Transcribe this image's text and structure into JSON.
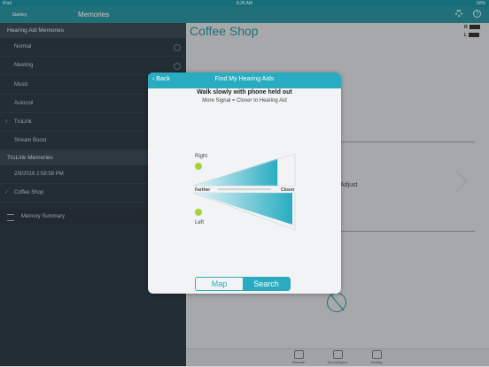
{
  "status_bar": {
    "left": "iPad",
    "time": "8:36 AM",
    "right": "50%"
  },
  "sidebar": {
    "logo": "Starkey",
    "title": "Memories",
    "sections": [
      {
        "label": "Hearing Aid Memories"
      },
      {
        "label": "TruLink Memories"
      }
    ],
    "hearing_aid_items": [
      {
        "label": "Normal",
        "checked": false
      },
      {
        "label": "Meeting",
        "checked": false
      },
      {
        "label": "Music",
        "checked": false
      },
      {
        "label": "Autocoil",
        "checked": false
      },
      {
        "label": "TruLink",
        "checked": true
      },
      {
        "label": "Stream Boost",
        "checked": false
      }
    ],
    "trulink_items": [
      {
        "label": "2/9/2016 2:58:58 PM",
        "checked": false
      },
      {
        "label": "Coffee Shop",
        "checked": true
      }
    ],
    "summary_label": "Memory Summary"
  },
  "main": {
    "title": "Coffee Shop",
    "battery_r": "R",
    "battery_l": "L",
    "adjust_label": "Adjust",
    "tabs": [
      {
        "label": "Remote"
      },
      {
        "label": "SoundSpace"
      },
      {
        "label": "Geotag"
      }
    ]
  },
  "dialog": {
    "back_label": "Back",
    "title": "Find My Hearing Aids",
    "instruction": "Walk slowly with phone held out",
    "hint": "More Signal = Closer to Hearing Aid",
    "right_label": "Right",
    "left_label": "Left",
    "farther_label": "Farther",
    "closer_label": "Closer",
    "signal": {
      "right": 0.85,
      "left": 1.0
    },
    "segments": {
      "map": "Map",
      "search": "Search",
      "selected": "search"
    },
    "accent_color": "#29acc1"
  }
}
